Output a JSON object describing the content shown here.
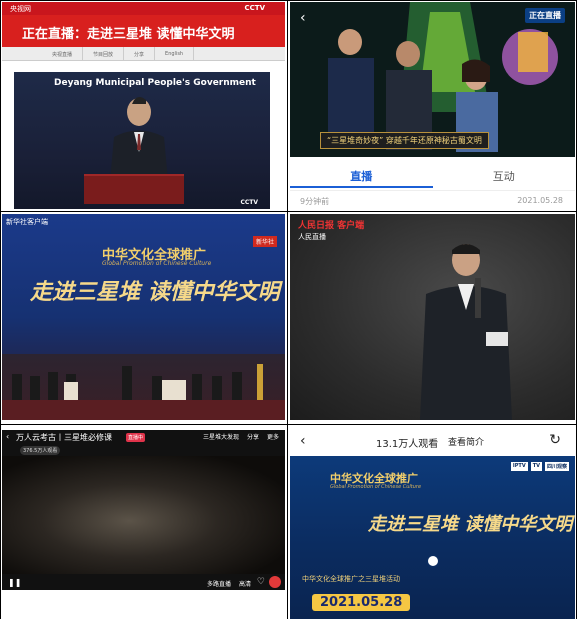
{
  "cell1": {
    "site_name": "央视网",
    "cctv_logo": "CCTV",
    "banner_title": "正在直播：走进三星堆 读懂中华文明",
    "nav_items": [
      "央视直播",
      "节目回放",
      "分享",
      "English"
    ],
    "caption": "Deyang Municipal People's Government",
    "watermark": "CCTV"
  },
  "cell2": {
    "badge": "正在直播",
    "lower_third": "“三星堆奇妙夜” 穿越千年还原神秘古蜀文明",
    "tabs": [
      {
        "label": "直播",
        "active": true
      },
      {
        "label": "互动",
        "active": false
      }
    ],
    "ago": "9分钟前",
    "date": "2021.05.28"
  },
  "cell3": {
    "source": "新华社客户端",
    "corner_badge": "新华社",
    "brand_cn": "中华文化全球推广",
    "brand_en": "Global Promotion of Chinese Culture",
    "title": "走进三星堆 读懂中华文明"
  },
  "cell4": {
    "logo": "人民日报 客户端",
    "sub_logo": "人民直播"
  },
  "cell5": {
    "title": "万人云考古丨三星堆必修课",
    "live_badge": "直播中",
    "viewers": "376.5万人观看",
    "right_items": [
      "三星堆大发现",
      "分享",
      "更多"
    ],
    "multi_live": "多路直播",
    "clarity": "高清"
  },
  "cell6": {
    "viewers": "13.1万人观看",
    "intro": "查看简介",
    "brand_cn": "中华文化全球推广",
    "brand_en": "Global Promotion of Chinese Culture",
    "logos": [
      "IPTV",
      "TV",
      "四川观察"
    ],
    "title": "走进三星堆 读懂中华文明",
    "subtitle": "中华文化全球推广之三星堆活动",
    "date": "2021.05.28"
  }
}
